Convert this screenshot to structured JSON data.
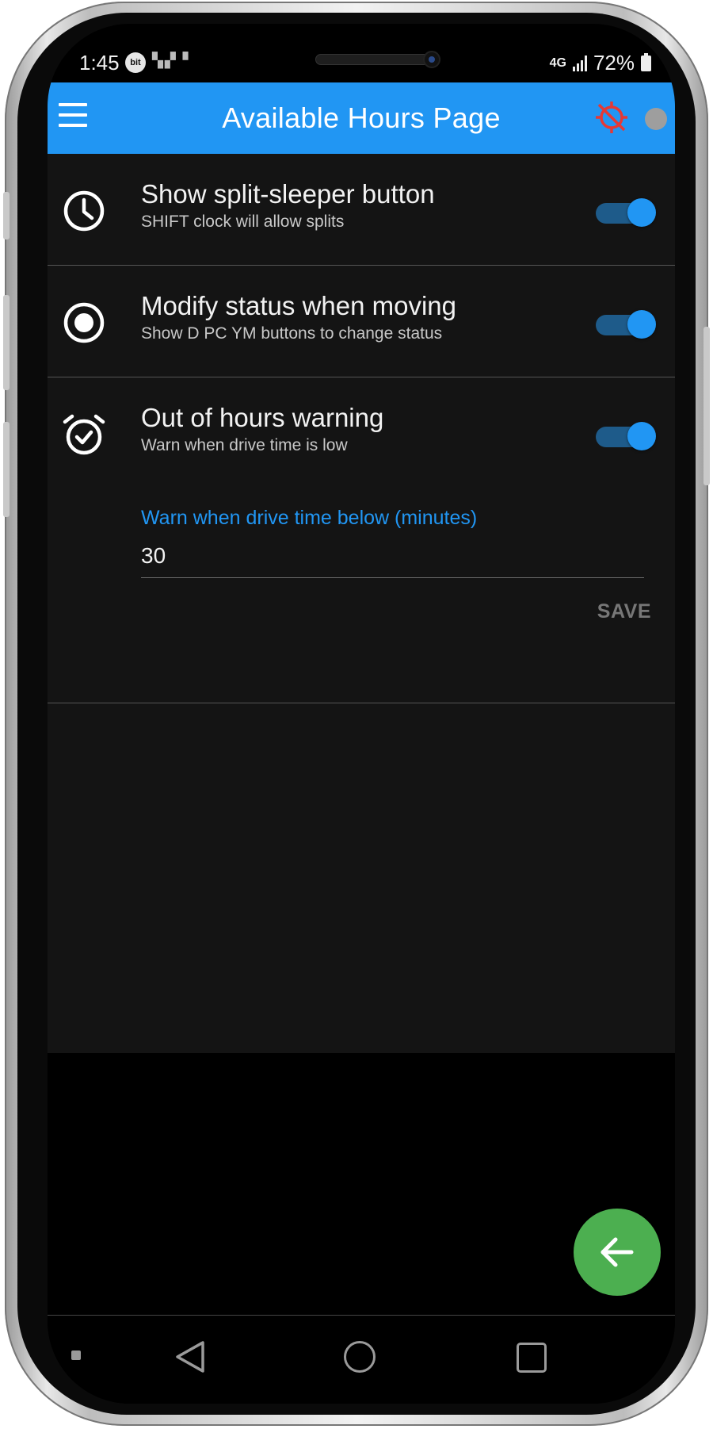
{
  "status_bar": {
    "time": "1:45",
    "notification_badge": "bit",
    "network": "4G",
    "battery": "72%"
  },
  "app_bar": {
    "title": "Available Hours Page",
    "gps_status_icon": "gps-off-icon",
    "connection_indicator_color": "#9e9e9e"
  },
  "settings": [
    {
      "icon": "clock-icon",
      "title": "Show split-sleeper button",
      "subtitle": "SHIFT clock will allow splits",
      "enabled": true
    },
    {
      "icon": "radio-button-icon",
      "title": "Modify status when moving",
      "subtitle": "Show D PC YM buttons to change status",
      "enabled": true
    },
    {
      "icon": "alarm-check-icon",
      "title": "Out of hours warning",
      "subtitle": "Warn when drive time is low",
      "enabled": true
    }
  ],
  "warning_field": {
    "label": "Warn when drive time below (minutes)",
    "value": "30"
  },
  "save_label": "SAVE",
  "fab": {
    "icon": "arrow-left-icon"
  },
  "nav_bar": {
    "back_icon": "triangle-back-icon",
    "home_icon": "circle-home-icon",
    "recents_icon": "square-recents-icon"
  },
  "colors": {
    "accent": "#2196f3",
    "fab": "#4caf50",
    "background": "#141414",
    "gps_off": "#e53935"
  }
}
